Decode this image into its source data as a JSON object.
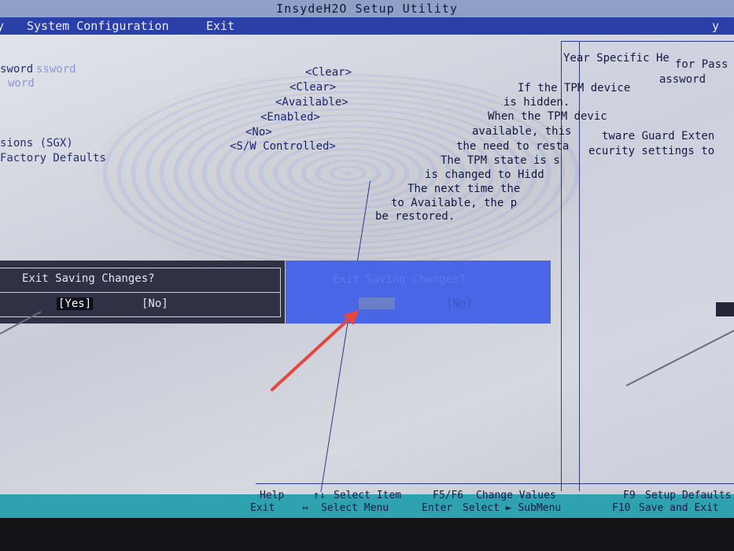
{
  "window": {
    "title": "InsydeH2O Setup Utility"
  },
  "menu": {
    "items": [
      "y",
      "System Configuration",
      "Exit",
      "y"
    ]
  },
  "settings": {
    "labels": [
      "sword",
      "Factory Defaults",
      "sions (SGX)"
    ],
    "ghost_labels": [
      "ssword",
      "word"
    ],
    "values": [
      "<Clear>",
      "<Clear>",
      "<Available>",
      "<Enabled>",
      "<No>",
      "<S/W Controlled>"
    ]
  },
  "help_panel": {
    "lines": [
      "Year Specific He",
      "If the TPM device",
      "is hidden.",
      "When the TPM devic",
      "available, this",
      "the need to resta",
      "The TPM state is s",
      "is changed to Hidd",
      "The next time the",
      "to Available, the p",
      "be restored."
    ]
  },
  "right_help": {
    "lines": [
      "for Pass",
      "assword",
      "tware Guard Exten",
      "ecurity settings to"
    ]
  },
  "dialog": {
    "question": "Exit Saving Changes?",
    "yes_label": "[Yes]",
    "no_label": "[No]"
  },
  "ghost_dialog": {
    "question": "Exit Saving Changes?",
    "no_label": "[No]"
  },
  "footer": {
    "row1": [
      {
        "key": "Help",
        "action": ""
      },
      {
        "key": "↑↓",
        "action": "Select Item"
      },
      {
        "key": "F5/F6",
        "action": "Change Values"
      },
      {
        "key": "F9",
        "action": "Setup Defaults"
      }
    ],
    "row2": [
      {
        "key": "Exit",
        "action": ""
      },
      {
        "key": "↔",
        "action": "Select Menu"
      },
      {
        "key": "Enter",
        "action": "Select ► SubMenu"
      },
      {
        "key": "F10",
        "action": "Save and Exit"
      }
    ]
  },
  "colors": {
    "menu_bar": "#2b3fa8",
    "dialog_bg": "#2f3144",
    "ghost_dialog_bg": "#4866e6",
    "footer_strip": "#2fa2b0",
    "annotation_arrow": "#e8463c"
  }
}
